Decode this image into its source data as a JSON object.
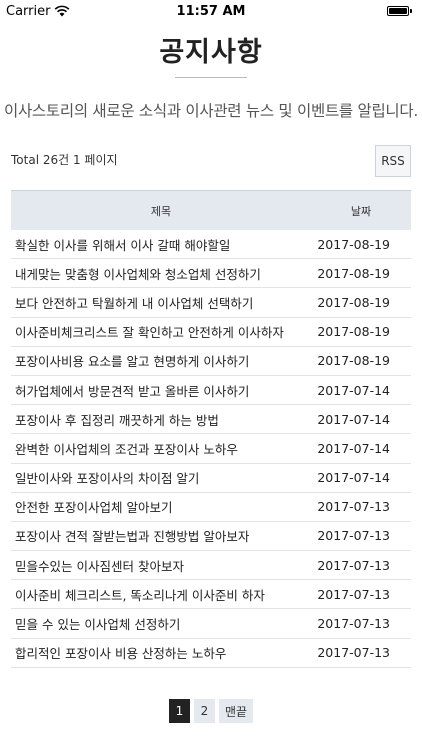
{
  "status_bar": {
    "carrier": "Carrier",
    "time": "11:57 AM"
  },
  "page": {
    "title": "공지사항",
    "subtitle": "이사스토리의 새로운 소식과 이사관련 뉴스 및 이벤트를 알립니다.",
    "summary": "Total 26건 1 페이지",
    "rss_label": "RSS"
  },
  "table": {
    "headers": {
      "title": "제목",
      "date": "날짜"
    },
    "rows": [
      {
        "title": "확실한 이사를 위해서 이사 갈때 해야할일",
        "date": "2017-08-19"
      },
      {
        "title": "내게맞는 맞춤형 이사업체와 청소업체 선정하기",
        "date": "2017-08-19"
      },
      {
        "title": "보다 안전하고 탁월하게 내 이사업체 선택하기",
        "date": "2017-08-19"
      },
      {
        "title": "이사준비체크리스트 잘 확인하고 안전하게 이사하자",
        "date": "2017-08-19"
      },
      {
        "title": "포장이사비용 요소를 알고 현명하게 이사하기",
        "date": "2017-08-19"
      },
      {
        "title": "허가업체에서 방문견적 받고 올바른 이사하기",
        "date": "2017-07-14"
      },
      {
        "title": "포장이사 후 집정리 깨끗하게 하는 방법",
        "date": "2017-07-14"
      },
      {
        "title": "완벽한 이사업체의 조건과 포장이사 노하우",
        "date": "2017-07-14"
      },
      {
        "title": "일반이사와 포장이사의 차이점 알기",
        "date": "2017-07-14"
      },
      {
        "title": "안전한 포장이사업체 알아보기",
        "date": "2017-07-13"
      },
      {
        "title": "포장이사 견적 잘받는법과 진행방법 알아보자",
        "date": "2017-07-13"
      },
      {
        "title": "믿을수있는 이사짐센터 찾아보자",
        "date": "2017-07-13"
      },
      {
        "title": "이사준비 체크리스트, 똑소리나게 이사준비 하자",
        "date": "2017-07-13"
      },
      {
        "title": "믿을 수 있는 이사업체 선정하기",
        "date": "2017-07-13"
      },
      {
        "title": "합리적인 포장이사 비용 산정하는 노하우",
        "date": "2017-07-13"
      }
    ]
  },
  "pagination": {
    "pages": [
      "1",
      "2"
    ],
    "current": "1",
    "last_label": "맨끝"
  }
}
